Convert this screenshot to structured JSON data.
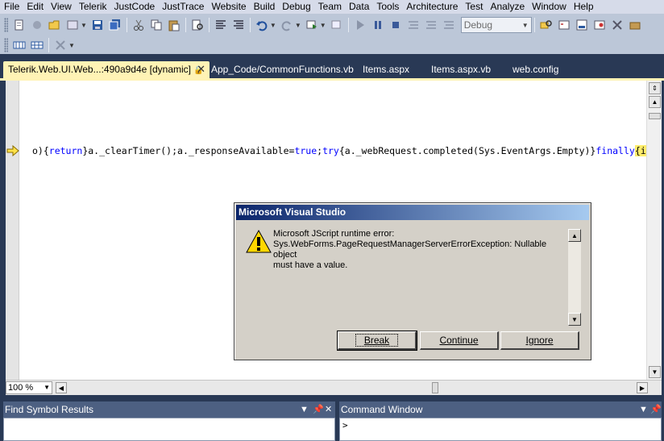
{
  "menu": [
    "File",
    "Edit",
    "View",
    "Telerik",
    "JustCode",
    "JustTrace",
    "Website",
    "Build",
    "Debug",
    "Team",
    "Data",
    "Tools",
    "Architecture",
    "Test",
    "Analyze",
    "Window",
    "Help"
  ],
  "toolbar": {
    "config_value": "Debug"
  },
  "tabs": [
    {
      "label": "Telerik.Web.UI.Web...:490a9d4e [dynamic]"
    },
    {
      "label": "App_Code/CommonFunctions.vb"
    },
    {
      "label": "Items.aspx"
    },
    {
      "label": "Items.aspx.vb"
    },
    {
      "label": "web.config"
    }
  ],
  "editor": {
    "code_line": [
      {
        "t": "o){",
        "k": ""
      },
      {
        "t": "return",
        "k": "kw"
      },
      {
        "t": "}a._clearTimer();a._responseAvailable=",
        "k": ""
      },
      {
        "t": "true",
        "k": "kw"
      },
      {
        "t": ";",
        "k": ""
      },
      {
        "t": "try",
        "k": "kw"
      },
      {
        "t": "{a._webRequest.completed(Sys.EventArgs.Empty)}",
        "k": ""
      },
      {
        "t": "finally",
        "k": "kw"
      },
      {
        "t": "{i",
        "k": "hl"
      }
    ],
    "zoom": "100 %"
  },
  "dialog": {
    "title": "Microsoft Visual Studio",
    "line1": "Microsoft JScript runtime error:",
    "line2": "Sys.WebForms.PageRequestManagerServerErrorException: Nullable object",
    "line3": "must have a value.",
    "btn_break": "Break",
    "btn_continue": "Continue",
    "btn_ignore": "Ignore"
  },
  "panels": {
    "left_title": "Find Symbol Results",
    "right_title": "Command Window",
    "right_prompt": ">"
  },
  "colors": {
    "chrome": "#293955",
    "active_tab": "#fff3b5",
    "panel_header": "#4d6082"
  }
}
